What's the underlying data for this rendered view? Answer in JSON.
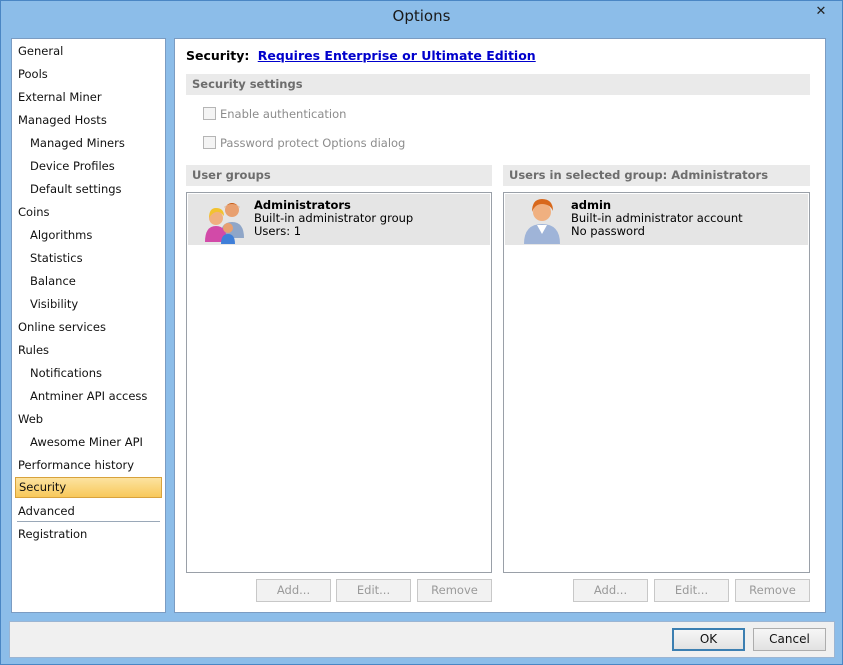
{
  "window": {
    "title": "Options",
    "close_glyph": "✕"
  },
  "nav": {
    "items": [
      {
        "label": "General",
        "level": 0
      },
      {
        "label": "Pools",
        "level": 0
      },
      {
        "label": "External Miner",
        "level": 0
      },
      {
        "label": "Managed Hosts",
        "level": 0
      },
      {
        "label": "Managed Miners",
        "level": 1
      },
      {
        "label": "Device Profiles",
        "level": 1
      },
      {
        "label": "Default settings",
        "level": 1
      },
      {
        "label": "Coins",
        "level": 0
      },
      {
        "label": "Algorithms",
        "level": 1
      },
      {
        "label": "Statistics",
        "level": 1
      },
      {
        "label": "Balance",
        "level": 1
      },
      {
        "label": "Visibility",
        "level": 1
      },
      {
        "label": "Online services",
        "level": 0
      },
      {
        "label": "Rules",
        "level": 0
      },
      {
        "label": "Notifications",
        "level": 1
      },
      {
        "label": "Antminer API access",
        "level": 1
      },
      {
        "label": "Web",
        "level": 0
      },
      {
        "label": "Awesome Miner API",
        "level": 1
      },
      {
        "label": "Performance history",
        "level": 0
      },
      {
        "label": "Security",
        "level": 0,
        "selected": true
      },
      {
        "label": "Advanced",
        "level": 0
      },
      {
        "label": "Registration",
        "level": 0
      }
    ]
  },
  "main": {
    "heading_label": "Security:",
    "heading_link": "Requires Enterprise or Ultimate Edition",
    "security_settings_header": "Security settings",
    "enable_auth_label": "Enable authentication",
    "password_protect_label": "Password protect Options dialog",
    "user_groups_header": "User groups",
    "users_header": "Users in selected group: Administrators",
    "groups": [
      {
        "name": "Administrators",
        "description": "Built-in administrator group",
        "count": "Users: 1"
      }
    ],
    "users": [
      {
        "name": "admin",
        "description": "Built-in administrator account",
        "password": "No password"
      }
    ],
    "group_buttons": {
      "add": "Add...",
      "edit": "Edit...",
      "remove": "Remove"
    },
    "user_buttons": {
      "add": "Add...",
      "edit": "Edit...",
      "remove": "Remove"
    }
  },
  "footer": {
    "ok": "OK",
    "cancel": "Cancel"
  },
  "colors": {
    "accent_selected": "#f8c85a",
    "link": "#0000cc",
    "frame": "#8cbde9"
  }
}
